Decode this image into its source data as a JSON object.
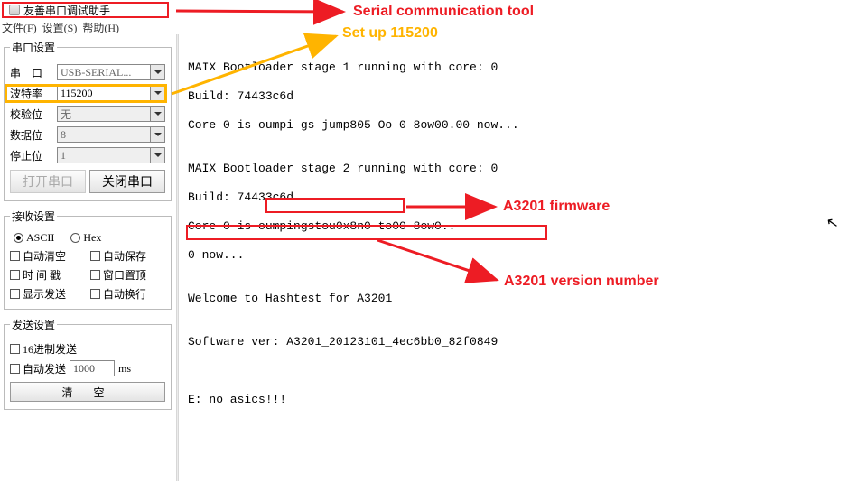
{
  "window": {
    "title": "友善串口调试助手"
  },
  "menu": {
    "file": "文件(F)",
    "settings": "设置(S)",
    "help": "帮助(H)"
  },
  "serial_settings": {
    "legend": "串口设置",
    "port_label": "串　口",
    "port_value": "USB-SERIAL...",
    "baud_label": "波特率",
    "baud_value": "115200",
    "parity_label": "校验位",
    "parity_value": "无",
    "databits_label": "数据位",
    "databits_value": "8",
    "stopbits_label": "停止位",
    "stopbits_value": "1",
    "open_btn": "打开串口",
    "close_btn": "关闭串口"
  },
  "recv_settings": {
    "legend": "接收设置",
    "ascii": "ASCII",
    "hex": "Hex",
    "auto_clear": "自动清空",
    "auto_save": "自动保存",
    "timestamp": "时 间 戳",
    "window_top": "窗口置顶",
    "show_send": "显示发送",
    "auto_wrap": "自动换行"
  },
  "send_settings": {
    "legend": "发送设置",
    "hex_send": "16进制发送",
    "auto_send": "自动发送",
    "interval_value": "1000",
    "interval_unit": "ms",
    "clear_btn": "清 空"
  },
  "console": {
    "l1": "MAIX Bootloader stage 1 running with core: 0",
    "l2": "Build: 74433c6d",
    "l3": "Core 0 is oumpi gs jump805 Oo 0 8ow00.00 now...",
    "l4": "",
    "l5": "MAIX Bootloader stage 2 running with core: 0",
    "l6": "Build: 74433c6d",
    "l7": "Core 0 is oumpingstou0x8n0 to00 8ow0..",
    "l8": "0 now...",
    "l9": "",
    "l10_a": "Welcome to ",
    "l10_b": "Hashtest for A3201",
    "l11": "",
    "l12_a": "Software ver: ",
    "l12_b": "A3201_20123101_4ec6bb0_82f0849",
    "l13": "",
    "l14": "",
    "l15": "E: no asics!!!"
  },
  "annotations": {
    "serial_tool": "Serial communication tool",
    "setup_baud": "Set up 115200",
    "firmware": "A3201 firmware",
    "version": "A3201 version number"
  }
}
